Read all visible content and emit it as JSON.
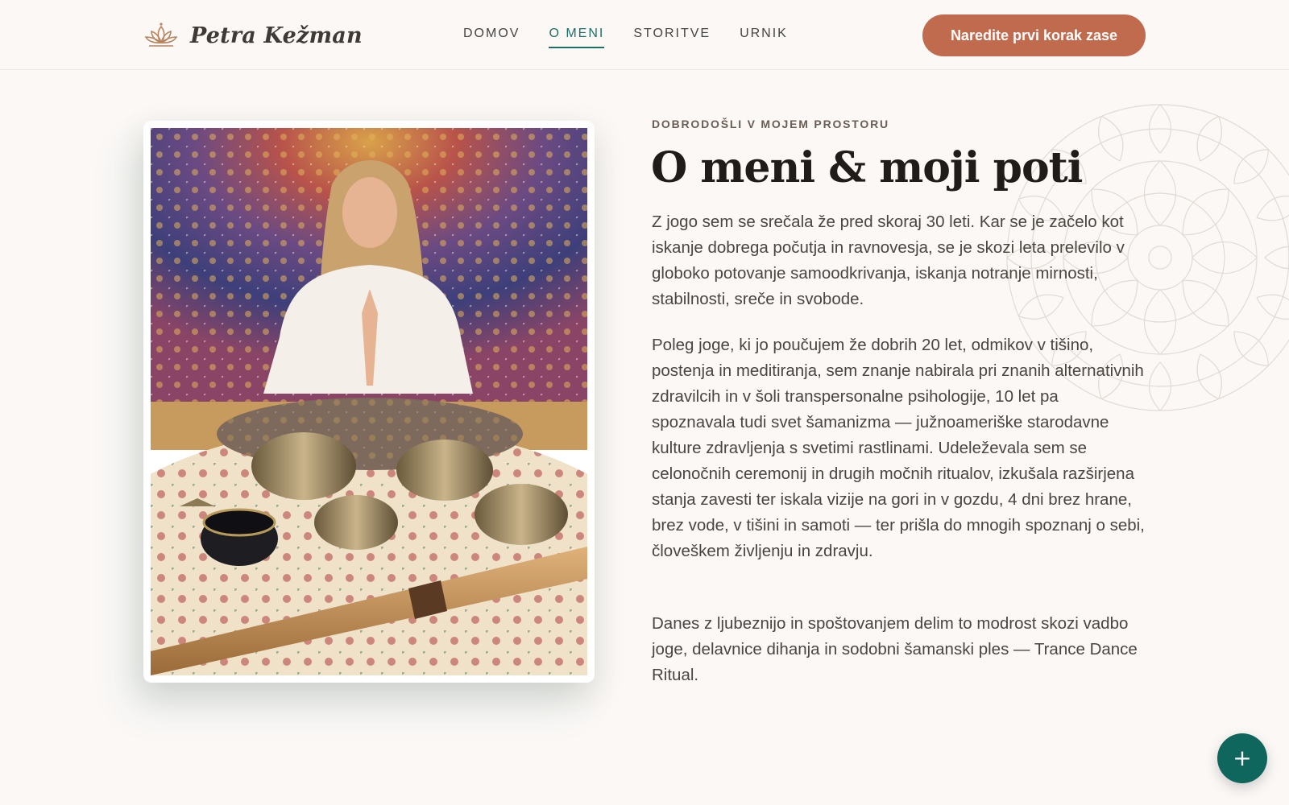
{
  "header": {
    "brand": "Petra Kežman",
    "logo_icon": "lotus-icon",
    "nav": [
      {
        "label": "DOMOV",
        "active": false
      },
      {
        "label": "O MENI",
        "active": true
      },
      {
        "label": "STORITVE",
        "active": false
      },
      {
        "label": "URNIK",
        "active": false
      }
    ],
    "cta_label": "Naredite prvi korak zase"
  },
  "main": {
    "photo_alt": "Petra meditira s pojočimi skledami",
    "kicker": "DOBRODOŠLI V MOJEM PROSTORU",
    "title": "O meni & moji poti",
    "paragraphs": [
      "Z jogo sem se srečala že pred skoraj 30 leti. Kar se je začelo kot iskanje dobrega počutja in ravnovesja, se je skozi leta prelevilo v globoko potovanje samoodkrivanja, iskanja notranje mirnosti, stabilnosti, sreče in svobode.",
      "Poleg joge, ki jo poučujem že dobrih 20 let, odmikov v tišino, postenja in meditiranja, sem znanje nabirala pri znanih alternativnih zdravilcih in v šoli transpersonalne psihologije, 10 let pa spoznavala tudi svet šamanizma — južnoameriške starodavne kulture zdravljenja s svetimi rastlinami. Udeleževala sem se celonočnih ceremonij in drugih močnih ritualov, izkušala razširjena stanja zavesti ter iskala vizije na gori in v gozdu, 4 dni brez hrane, brez vode, v tišini in samoti — ter prišla do mnogih spoznanj o sebi, človeškem življenju in zdravju.",
      "Danes z ljubeznijo in spoštovanjem delim to modrost skozi vadbo joge, delavnice dihanja in sodobni šamanski ples — Trance Dance Ritual."
    ]
  },
  "fab": {
    "label": "+",
    "icon": "plus-icon"
  },
  "colors": {
    "accent": "#c06a4e",
    "teal": "#0f665c",
    "background": "#fbf8f6"
  }
}
